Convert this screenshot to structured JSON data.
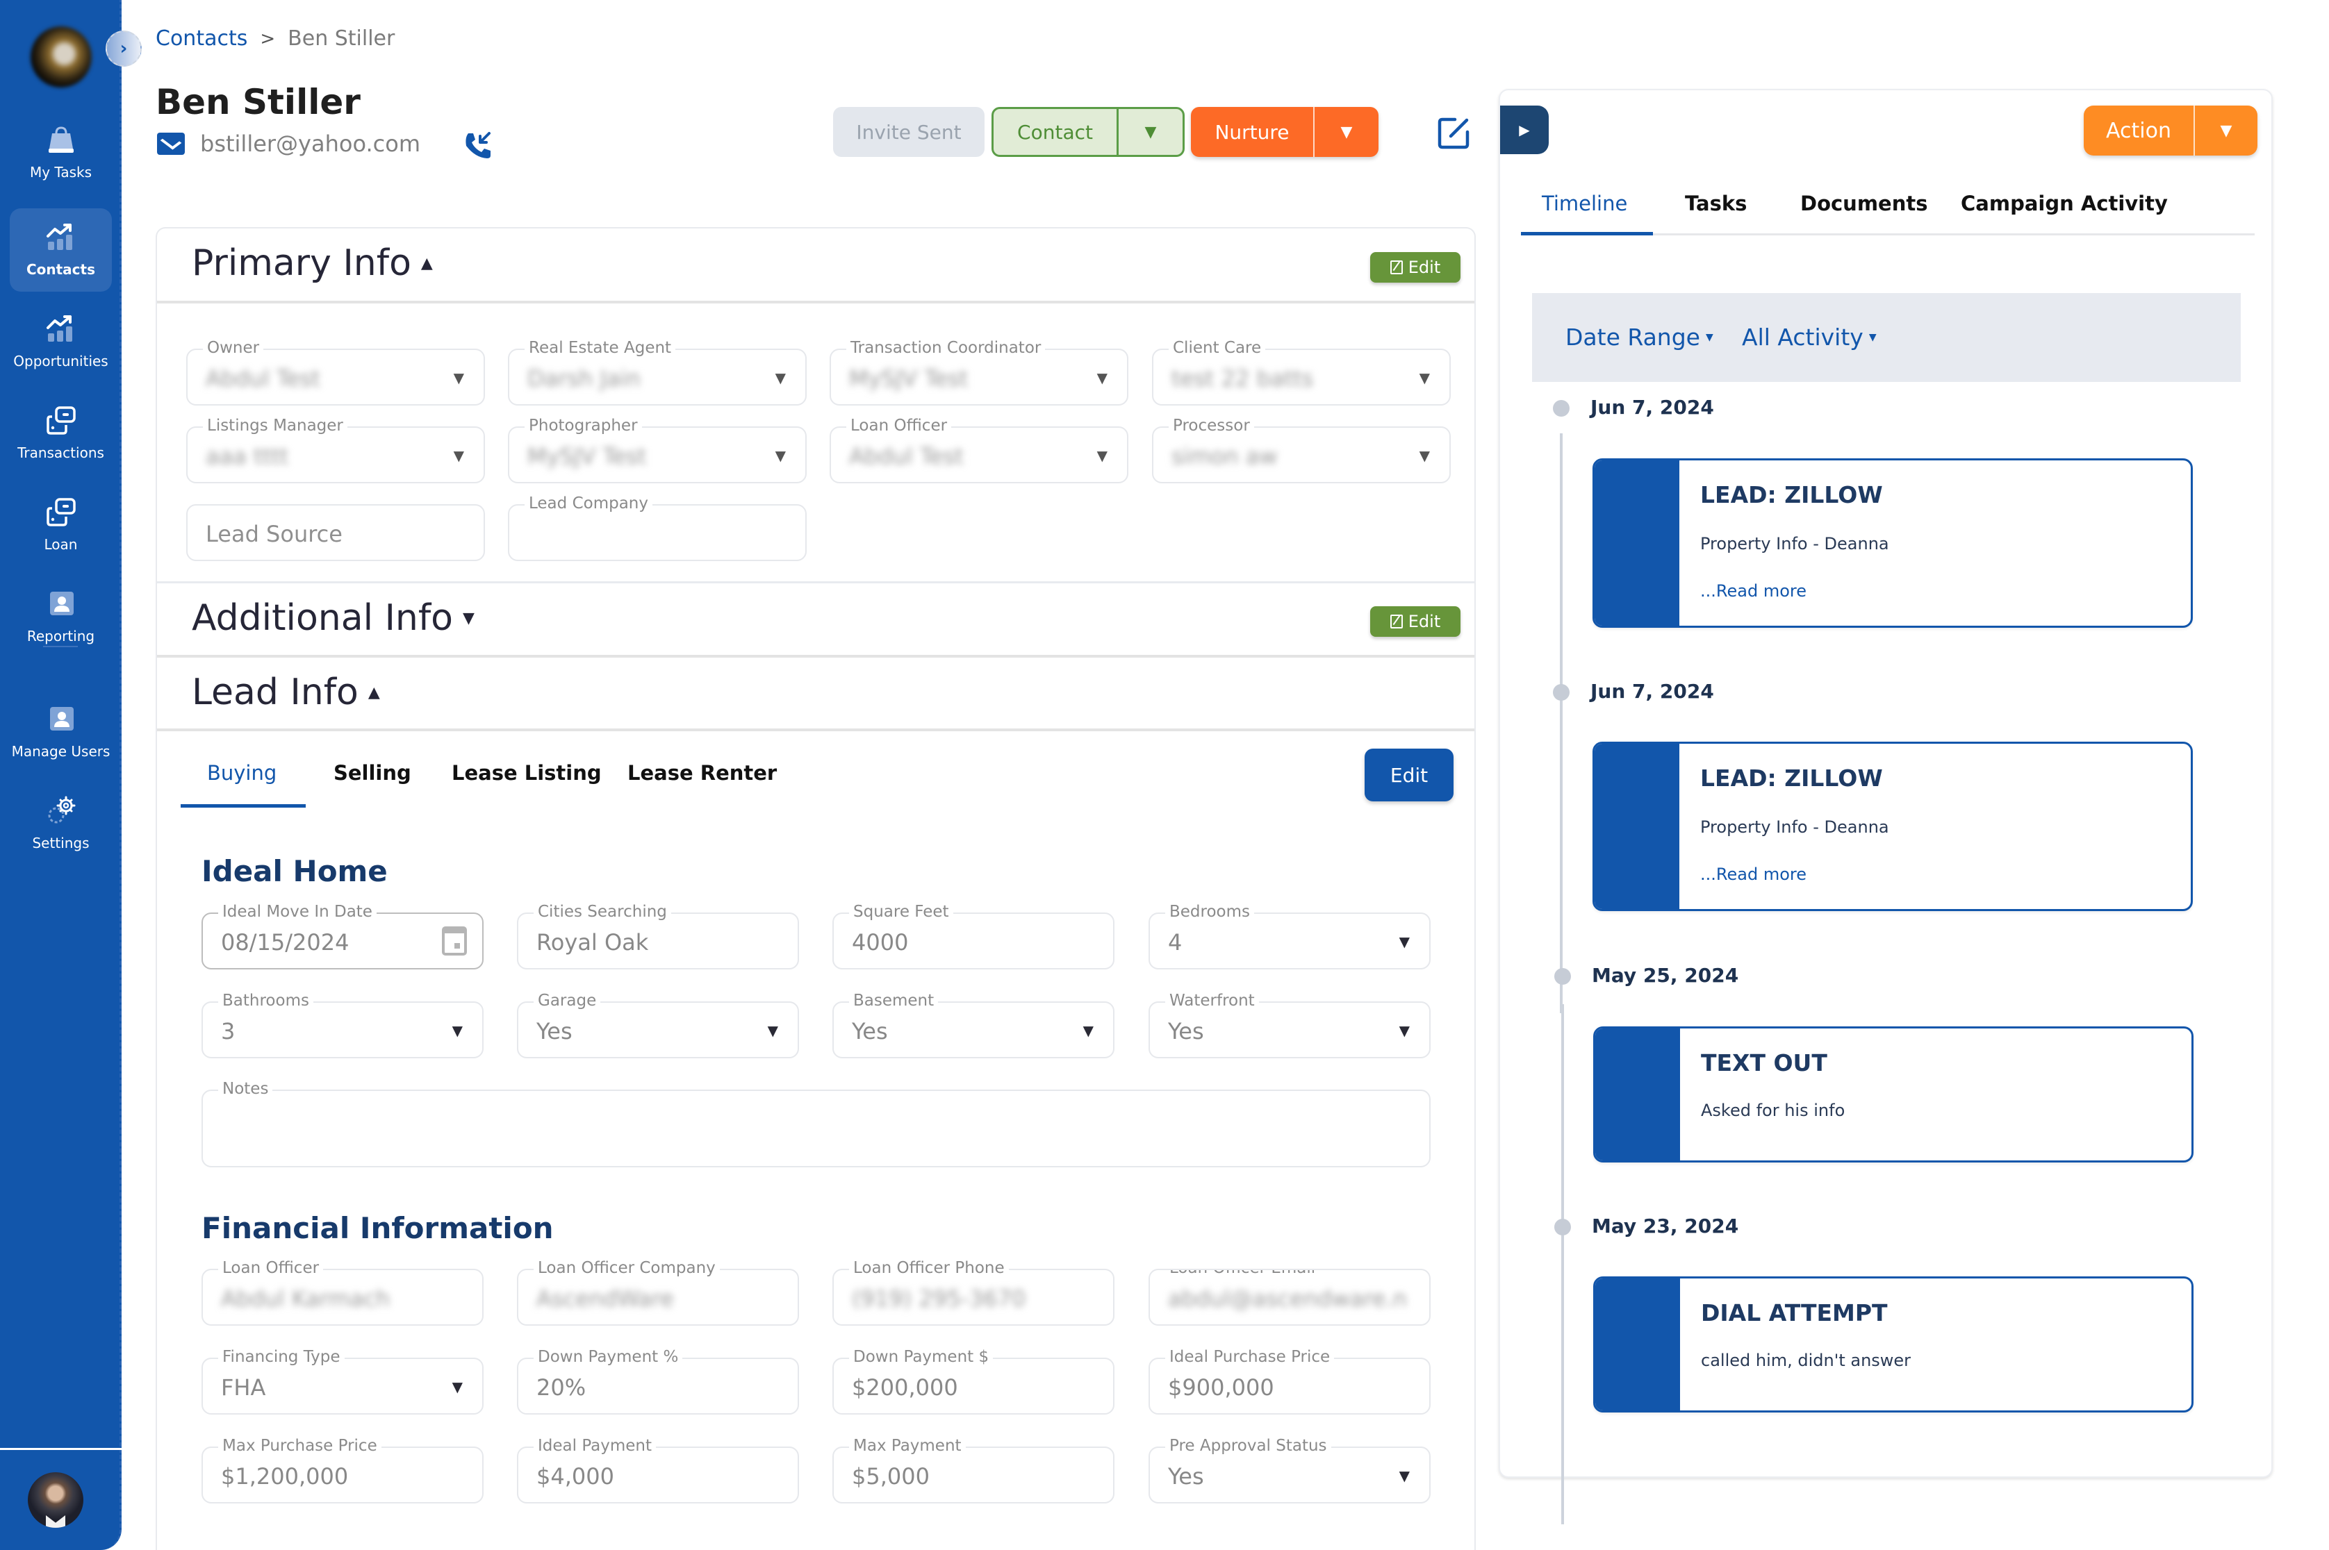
{
  "sidebar": {
    "items": [
      {
        "label": "My Tasks",
        "icon": "bag-icon",
        "active": false
      },
      {
        "label": "Contacts",
        "icon": "chart-up-icon",
        "active": true
      },
      {
        "label": "Opportunities",
        "icon": "chart-up-icon",
        "active": false
      },
      {
        "label": "Transactions",
        "icon": "cards-icon",
        "active": false
      },
      {
        "label": "Loan",
        "icon": "cards-icon",
        "active": false
      },
      {
        "label": "Reporting",
        "icon": "user-square-icon",
        "active": false
      },
      {
        "label": "Manage Users",
        "icon": "user-square-icon",
        "active": false
      },
      {
        "label": "Settings",
        "icon": "gears-icon",
        "active": false
      }
    ]
  },
  "breadcrumb": {
    "parent": "Contacts",
    "separator": ">",
    "current": "Ben Stiller"
  },
  "contact": {
    "name": "Ben Stiller",
    "email": "bstiller@yahoo.com"
  },
  "header_buttons": {
    "invite": "Invite Sent",
    "contact": "Contact",
    "nurture": "Nurture"
  },
  "colors": {
    "brand_blue": "#1256ab",
    "green": "#67953a",
    "orange_nurture": "#fd6a26",
    "orange_action": "#fe8c23"
  },
  "primary_info": {
    "title": "Primary Info",
    "edit_label": "Edit",
    "fields": [
      {
        "label": "Owner",
        "value": "Abdul Test"
      },
      {
        "label": "Real Estate Agent",
        "value": "Darsh Jain"
      },
      {
        "label": "Transaction Coordinator",
        "value": "MySJV Test"
      },
      {
        "label": "Client Care",
        "value": "test 22 batts"
      },
      {
        "label": "Listings Manager",
        "value": "aaa tttt"
      },
      {
        "label": "Photographer",
        "value": "MySJV Test"
      },
      {
        "label": "Loan Officer",
        "value": "Abdul Test"
      },
      {
        "label": "Processor",
        "value": "simon aw"
      }
    ],
    "lead_source_placeholder": "Lead Source",
    "lead_company_label": "Lead Company",
    "lead_company_value": ""
  },
  "additional_info": {
    "title": "Additional Info",
    "edit_label": "Edit"
  },
  "lead_info": {
    "title": "Lead Info",
    "tabs": [
      "Buying",
      "Selling",
      "Lease Listing",
      "Lease Renter"
    ],
    "active_tab": "Buying",
    "edit_label": "Edit",
    "ideal_home": {
      "title": "Ideal Home",
      "fields": [
        {
          "label": "Ideal Move In Date",
          "value": "08/15/2024",
          "type": "date"
        },
        {
          "label": "Cities Searching",
          "value": "Royal Oak",
          "type": "text"
        },
        {
          "label": "Square Feet",
          "value": "4000",
          "type": "text"
        },
        {
          "label": "Bedrooms",
          "value": "4",
          "type": "select"
        },
        {
          "label": "Bathrooms",
          "value": "3",
          "type": "select"
        },
        {
          "label": "Garage",
          "value": "Yes",
          "type": "select"
        },
        {
          "label": "Basement",
          "value": "Yes",
          "type": "select"
        },
        {
          "label": "Waterfront",
          "value": "Yes",
          "type": "select"
        }
      ],
      "notes_label": "Notes",
      "notes_value": ""
    },
    "financial": {
      "title": "Financial Information",
      "fields": [
        {
          "label": "Loan Officer",
          "value": "Abdul Karmach",
          "type": "text",
          "blurred": true
        },
        {
          "label": "Loan Officer Company",
          "value": "AscendWare",
          "type": "text",
          "blurred": true
        },
        {
          "label": "Loan Officer Phone",
          "value": "(919) 295-3670",
          "type": "text",
          "blurred": true
        },
        {
          "label": "Loan Officer Email",
          "value": "abdul@ascendware.n",
          "type": "text",
          "blurred": true
        },
        {
          "label": "Financing Type",
          "value": "FHA",
          "type": "select"
        },
        {
          "label": "Down Payment %",
          "value": "20%",
          "type": "text"
        },
        {
          "label": "Down Payment $",
          "value": "$200,000",
          "type": "text"
        },
        {
          "label": "Ideal Purchase Price",
          "value": "$900,000",
          "type": "text"
        },
        {
          "label": "Max Purchase Price",
          "value": "$1,200,000",
          "type": "text"
        },
        {
          "label": "Ideal Payment",
          "value": "$4,000",
          "type": "text"
        },
        {
          "label": "Max Payment",
          "value": "$5,000",
          "type": "text"
        },
        {
          "label": "Pre Approval Status",
          "value": "Yes",
          "type": "select"
        }
      ]
    }
  },
  "right_panel": {
    "action_label": "Action",
    "tabs": [
      "Timeline",
      "Tasks",
      "Documents",
      "Campaign Activity"
    ],
    "active_tab": "Timeline",
    "filters": [
      "Date Range",
      "All Activity"
    ],
    "timeline": [
      {
        "date": "Jun 7, 2024",
        "title": "LEAD: ZILLOW",
        "description": "Property Info - Deanna",
        "read_more": "...Read more"
      },
      {
        "date": "Jun 7, 2024",
        "title": "LEAD: ZILLOW",
        "description": "Property Info - Deanna",
        "read_more": "...Read more"
      },
      {
        "date": "May 25, 2024",
        "title": "TEXT OUT",
        "description": "Asked for his info",
        "read_more": null
      },
      {
        "date": "May 23, 2024",
        "title": "DIAL ATTEMPT",
        "description": "called him, didn't answer",
        "read_more": null
      }
    ]
  }
}
